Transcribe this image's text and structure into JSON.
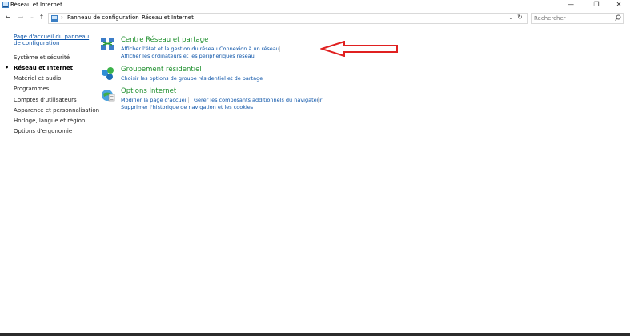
{
  "window": {
    "title": "Réseau et Internet",
    "icon": "control-panel-icon",
    "controls": [
      "minimize-icon",
      "restore-icon",
      "close-icon"
    ]
  },
  "address": {
    "crumbs": [
      "Panneau de configuration",
      "Réseau et Internet"
    ],
    "search_placeholder": "Rechercher"
  },
  "sidebar": {
    "home": "Page d'accueil du panneau de configuration",
    "items": [
      "Système et sécurité",
      "Réseau et Internet",
      "Matériel et audio",
      "Programmes",
      "Comptes d'utilisateurs",
      "Apparence et personnalisation",
      "Horloge, langue et région",
      "Options d'ergonomie"
    ],
    "active_index": 1
  },
  "categories": [
    {
      "title": "Centre Réseau et partage",
      "icon": "network-center-icon",
      "tasks": [
        "Afficher l'état et la gestion du réseau",
        "Connexion à un réseau",
        "Afficher les ordinateurs et les périphériques réseau"
      ]
    },
    {
      "title": "Groupement résidentiel",
      "icon": "homegroup-icon",
      "tasks": [
        "Choisir les options de groupe résidentiel et de partage"
      ]
    },
    {
      "title": "Options Internet",
      "icon": "internet-options-icon",
      "tasks": [
        "Modifier la page d'accueil",
        "Gérer les composants additionnels du navigateur",
        "Supprimer l'historique de navigation et les cookies"
      ]
    }
  ],
  "annotation": {
    "arrow_color": "#e02020"
  },
  "colors": {
    "link": "#0b53a8",
    "category_title": "#1d8e2c"
  }
}
